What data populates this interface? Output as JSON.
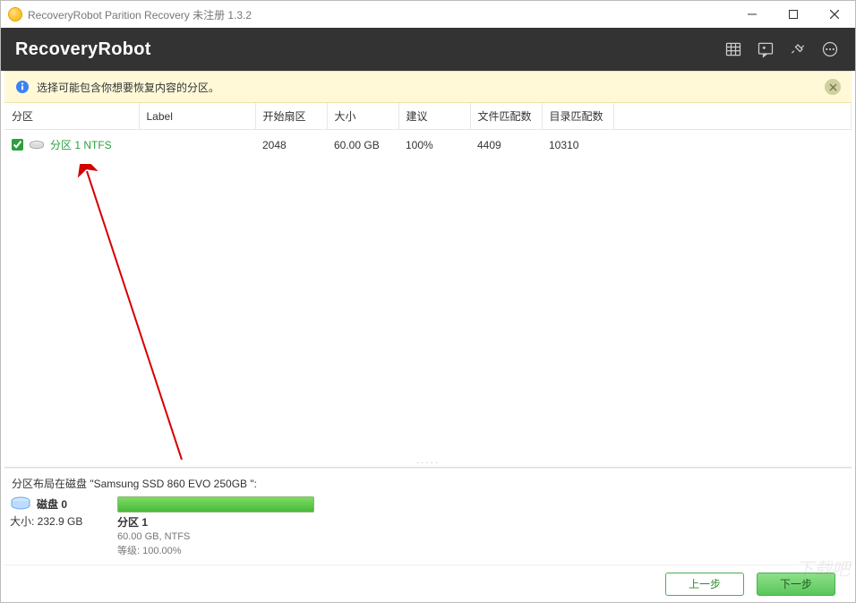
{
  "window": {
    "title": "RecoveryRobot Parition Recovery 未注册 1.3.2"
  },
  "header": {
    "brand": "RecoveryRobot"
  },
  "infobar": {
    "message": "选择可能包含你想要恢复内容的分区。"
  },
  "table": {
    "headers": {
      "partition": "分区",
      "label": "Label",
      "start_sector": "开始扇区",
      "size": "大小",
      "suggestion": "建议",
      "file_matches": "文件匹配数",
      "dir_matches": "目录匹配数"
    },
    "rows": [
      {
        "checked": true,
        "name": "分区 1 NTFS",
        "label": "",
        "start_sector": "2048",
        "size": "60.00 GB",
        "suggestion": "100%",
        "file_matches": "4409",
        "dir_matches": "10310"
      }
    ]
  },
  "layout": {
    "title_prefix": "分区布局在磁盘 ",
    "disk_model_quoted": "\"Samsung SSD 860 EVO 250GB \":",
    "disk_label_prefix": "磁盘 ",
    "disk_index": "0",
    "disk_size_prefix": "大小: ",
    "disk_size": "232.9 GB",
    "part": {
      "name": "分区 1",
      "sub1": "60.00 GB, NTFS",
      "sub2_prefix": "等级: ",
      "sub2_value": "100.00%"
    }
  },
  "footer": {
    "prev": "上一步",
    "next": "下一步"
  }
}
